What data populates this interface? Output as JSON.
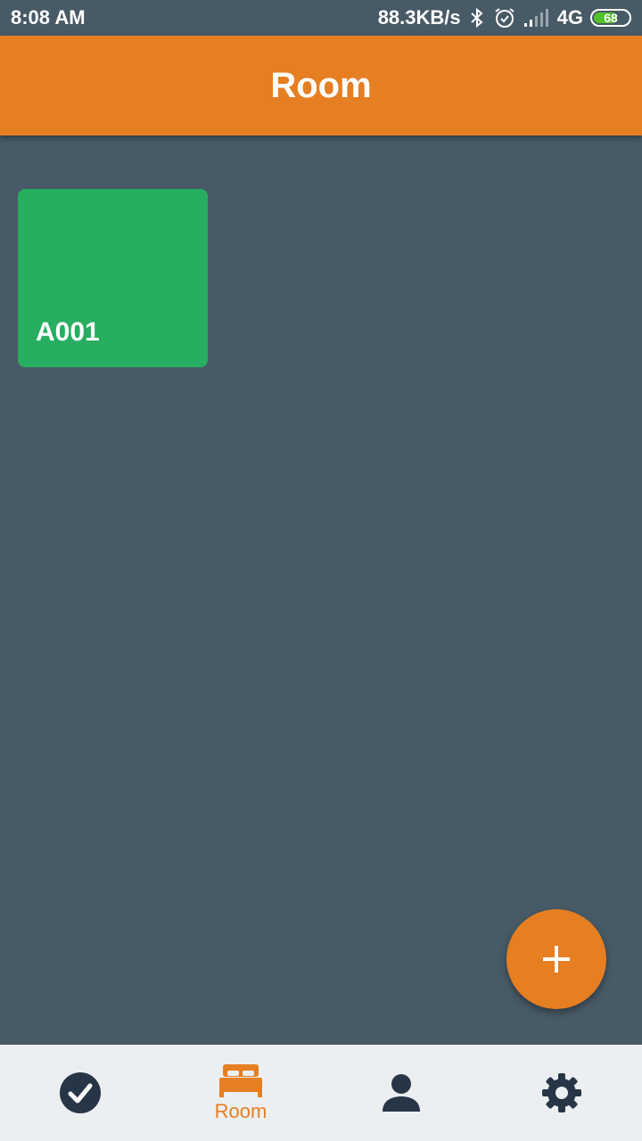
{
  "status_bar": {
    "time": "8:08 AM",
    "net_speed": "88.3KB/s",
    "network": "4G",
    "battery": "68",
    "icons": [
      "bluetooth-icon",
      "alarm-icon",
      "signal-icon",
      "battery-icon"
    ]
  },
  "header": {
    "title": "Room"
  },
  "rooms": [
    {
      "name": "A001"
    }
  ],
  "fab": {
    "icon": "plus-icon"
  },
  "bottom_nav": {
    "items": [
      {
        "icon": "check-circle-icon",
        "label": ""
      },
      {
        "icon": "bed-icon",
        "label": "Room",
        "active": true
      },
      {
        "icon": "person-icon",
        "label": ""
      },
      {
        "icon": "gear-icon",
        "label": ""
      }
    ]
  },
  "colors": {
    "accent": "#e67e22",
    "background": "#475a66",
    "tile": "#27ae60",
    "nav_background": "#eceff1",
    "nav_icon": "#273647"
  }
}
